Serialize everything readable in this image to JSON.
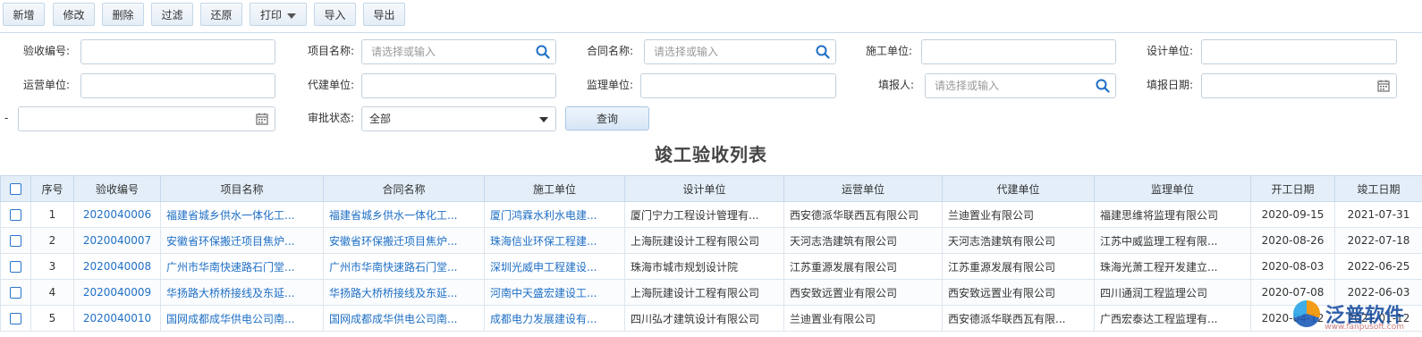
{
  "toolbar": {
    "buttons": [
      "新增",
      "修改",
      "删除",
      "过滤",
      "还原",
      "打印",
      "导入",
      "导出"
    ]
  },
  "filters": {
    "acceptance_no": {
      "label": "验收编号:",
      "value": ""
    },
    "project_name": {
      "label": "项目名称:",
      "placeholder": "请选择或输入"
    },
    "contract_name": {
      "label": "合同名称:",
      "placeholder": "请选择或输入"
    },
    "construction_unit": {
      "label": "施工单位:",
      "value": ""
    },
    "design_unit": {
      "label": "设计单位:",
      "value": ""
    },
    "operation_unit": {
      "label": "运营单位:",
      "value": ""
    },
    "agent_unit": {
      "label": "代建单位:",
      "value": ""
    },
    "supervision_unit": {
      "label": "监理单位:",
      "value": ""
    },
    "reporter": {
      "label": "填报人:",
      "placeholder": "请选择或输入"
    },
    "report_date": {
      "label": "填报日期:",
      "value": ""
    },
    "range_dash": "-",
    "approval_status": {
      "label": "审批状态:",
      "value": "全部"
    },
    "query_label": "查询"
  },
  "table": {
    "title": "竣工验收列表",
    "columns": [
      "序号",
      "验收编号",
      "项目名称",
      "合同名称",
      "施工单位",
      "设计单位",
      "运营单位",
      "代建单位",
      "监理单位",
      "开工日期",
      "竣工日期"
    ],
    "rows": [
      [
        "1",
        "2020040006",
        "福建省城乡供水一体化工...",
        "福建省城乡供水一体化工...",
        "厦门鸿霖水利水电建...",
        "厦门宁力工程设计管理有...",
        "西安德派华联西瓦有限公司",
        "兰迪置业有限公司",
        "福建思维将监理有限公司",
        "2020-09-15",
        "2021-07-31"
      ],
      [
        "2",
        "2020040007",
        "安徽省环保搬迁项目焦炉...",
        "安徽省环保搬迁项目焦炉...",
        "珠海信业环保工程建...",
        "上海阮建设计工程有限公司",
        "天河志浩建筑有限公司",
        "天河志浩建筑有限公司",
        "江苏中威监理工程有限...",
        "2020-08-26",
        "2022-07-18"
      ],
      [
        "3",
        "2020040008",
        "广州市华南快速路石门堂...",
        "广州市华南快速路石门堂...",
        "深圳光威申工程建设...",
        "珠海市城市规划设计院",
        "江苏重源发展有限公司",
        "江苏重源发展有限公司",
        "珠海光萧工程开发建立...",
        "2020-08-03",
        "2022-06-25"
      ],
      [
        "4",
        "2020040009",
        "华扬路大桥桥接线及东延...",
        "华扬路大桥桥接线及东延...",
        "河南中天盛宏建设工...",
        "上海阮建设计工程有限公司",
        "西安致远置业有限公司",
        "西安致远置业有限公司",
        "四川通润工程监理公司",
        "2020-07-08",
        "2022-06-03"
      ],
      [
        "5",
        "2020040010",
        "国网成都成华供电公司南...",
        "国网成都成华供电公司南...",
        "成都电力发展建设有...",
        "四川弘才建筑设计有限公司",
        "兰迪置业有限公司",
        "西安德派华联西瓦有限...",
        "广西宏泰达工程监理有...",
        "2020-04-12",
        "2021-01-12"
      ]
    ]
  },
  "watermark": {
    "text": "泛普软件",
    "url": "www.fanpusoft.com"
  }
}
